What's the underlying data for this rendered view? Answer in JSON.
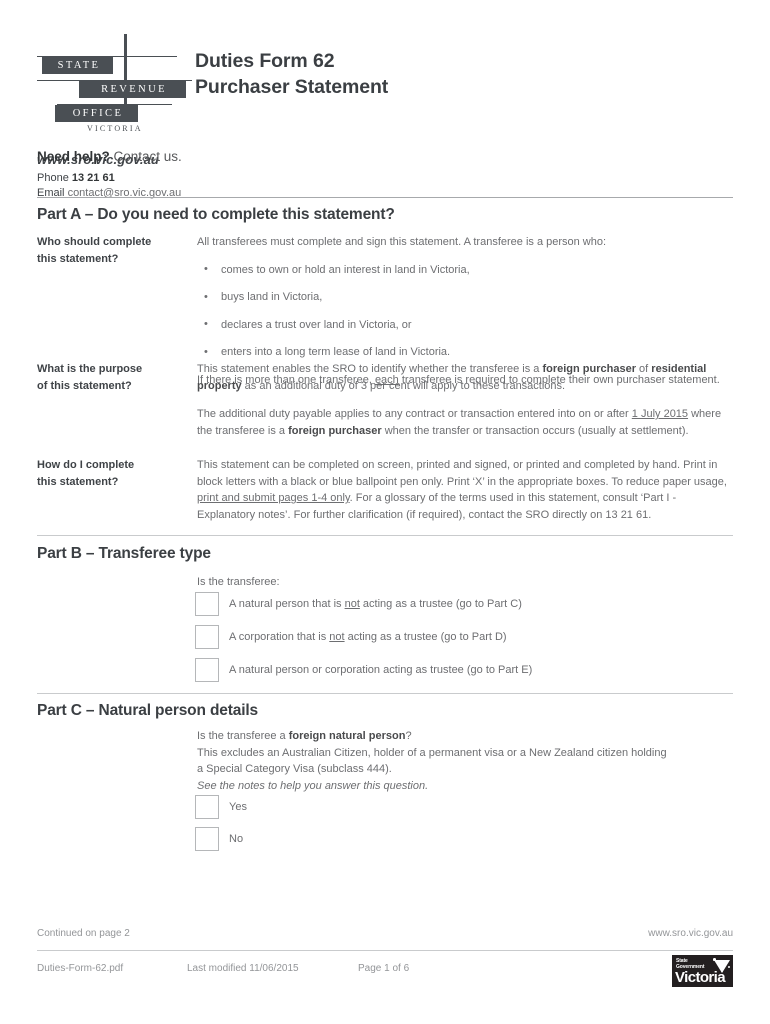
{
  "header": {
    "logo": {
      "line1": "STATE",
      "line2": "REVENUE",
      "line3": "OFFICE",
      "line4": "VICTORIA"
    },
    "website": "www.sro.vic.gov.au",
    "title_line1": "Duties Form 62",
    "title_line2": "Purchaser Statement"
  },
  "contact": {
    "need_help_bold": "Need help?",
    "need_help_rest": " Contact us.",
    "phone_label": "Phone ",
    "phone_value": "13 21 61",
    "email_label": "Email ",
    "email_value": "contact@sro.vic.gov.au"
  },
  "part_a": {
    "heading": "Part A – Do you need to complete this statement?",
    "rows": [
      {
        "label_line1": "Who should complete",
        "label_line2": "this statement?",
        "intro": "All transferees must complete and sign this statement. A transferee is a person who:",
        "bullets": [
          "comes to own or hold an interest in land in Victoria,",
          "buys land in Victoria,",
          "declares a trust over land in Victoria, or",
          "enters into a long term lease of land in Victoria."
        ],
        "closing_pre": "If there is more than one transferee, ",
        "closing_underline": "each",
        "closing_post": " transferee is required to complete their own purchaser statement."
      },
      {
        "label_line1": "What is the purpose",
        "label_line2": "of this statement?",
        "p1_a": "This statement enables the SRO to identify whether the transferee is a ",
        "p1_b": "foreign purchaser",
        "p1_c": " of ",
        "p1_d": "residential property",
        "p1_e": " as an additional duty of 3 per cent will apply to these transactions.",
        "p2_a": "The additional duty payable applies to any contract or transaction entered into on or after ",
        "p2_b": "1 July 2015",
        "p2_c": " where the transferee is a ",
        "p2_d": "foreign purchaser",
        "p2_e": " when the transfer or transaction occurs (usually at settlement)."
      },
      {
        "label_line1": "How do I complete",
        "label_line2": "this statement?",
        "p1_a": "This statement can be completed on screen, printed and signed, or printed and completed by hand. Print in block letters with a black or blue ballpoint pen only. Print ‘X’ in the appropriate boxes. To reduce paper usage, ",
        "p1_b": "print and submit pages 1-4 only",
        "p1_c": ". For a glossary of the terms used in this statement, consult ‘Part I - Explanatory notes’. For further clarification (if required), contact the SRO directly on 13 21 61."
      }
    ]
  },
  "part_b": {
    "heading": "Part B – Transferee type",
    "question": "Is the transferee:",
    "options": [
      {
        "pre": "A natural person that is ",
        "underline": "not",
        "post": " acting as a trustee (go to Part C)"
      },
      {
        "pre": "A corporation that is ",
        "underline": "not",
        "post": " acting as a trustee (go to Part D)"
      },
      {
        "pre": "A natural person or corporation acting as trustee (go to Part E)",
        "underline": "",
        "post": ""
      }
    ]
  },
  "part_c": {
    "heading": "Part C – Natural person details",
    "q_pre": "Is the transferee a ",
    "q_bold": "foreign natural person",
    "q_post": "?",
    "note_line1": "This excludes an Australian Citizen, holder of a permanent visa or a New Zealand citizen holding",
    "note_line2": "a Special Category Visa (subclass 444).",
    "italic_note": "See the notes to help you answer this question.",
    "options": [
      {
        "label": "Yes"
      },
      {
        "label": "No"
      }
    ]
  },
  "footer": {
    "continued": "Continued on page 2",
    "website": "www.sro.vic.gov.au",
    "filename": "Duties-Form-62.pdf",
    "last_modified": "Last modified 11/06/2015",
    "page_number": "Page 1 of 6",
    "vic_logo_gov_line1": "State",
    "vic_logo_gov_line2": "Government",
    "vic_logo_name": "Victoria"
  },
  "colors": {
    "ink": "#58595b",
    "heading": "#3b3f43",
    "rule": "#a7a9ac",
    "logo": "#4a4f54"
  }
}
